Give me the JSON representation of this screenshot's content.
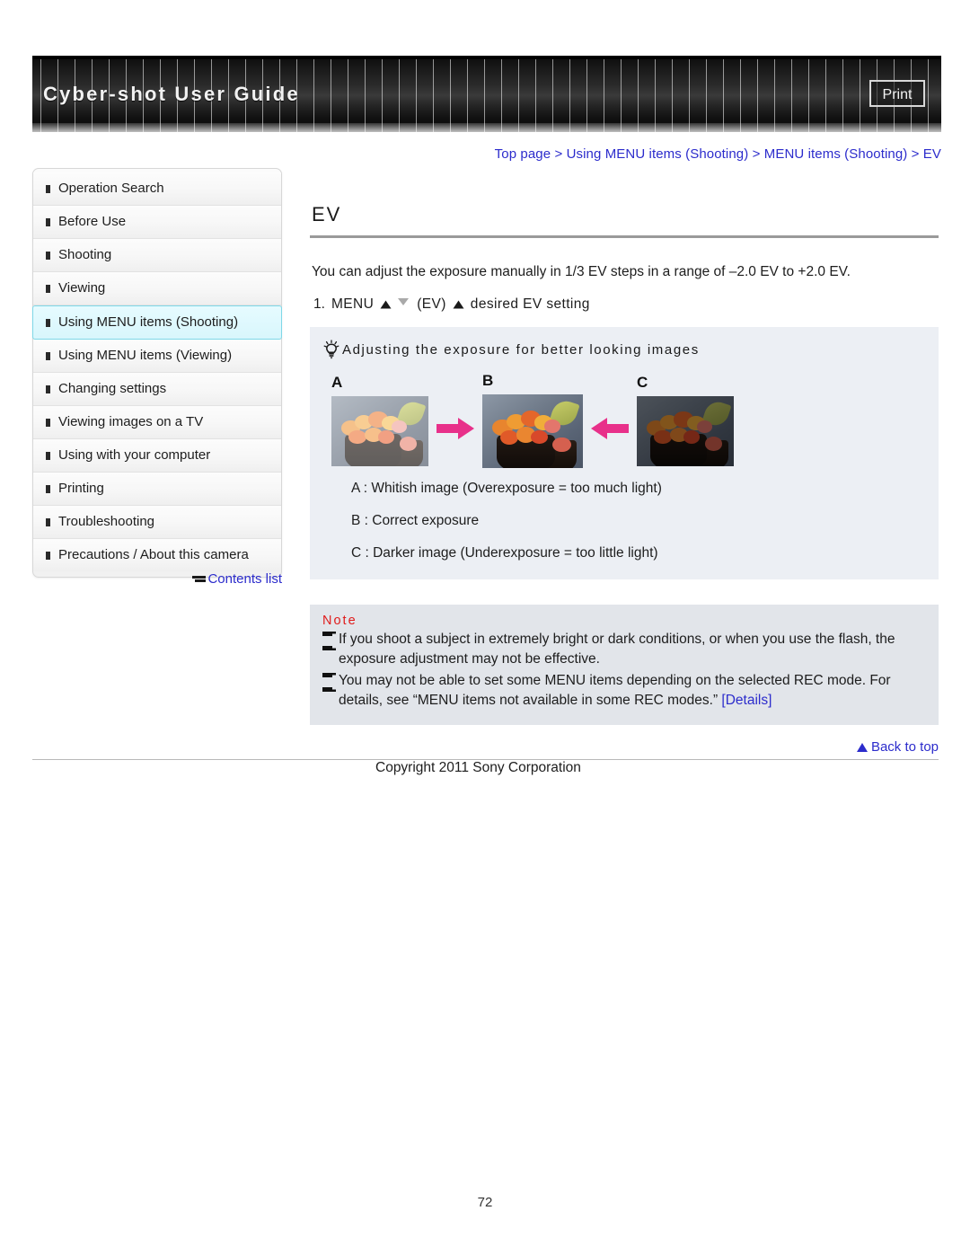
{
  "header": {
    "title": "Cyber-shot User Guide",
    "print_label": "Print"
  },
  "breadcrumb": {
    "text": "Top page > Using MENU items (Shooting) > MENU items (Shooting) > EV"
  },
  "sidebar": {
    "items": [
      {
        "label": "Operation Search",
        "active": false
      },
      {
        "label": "Before Use",
        "active": false
      },
      {
        "label": "Shooting",
        "active": false
      },
      {
        "label": "Viewing",
        "active": false
      },
      {
        "label": "Using MENU items (Shooting)",
        "active": true
      },
      {
        "label": "Using MENU items (Viewing)",
        "active": false
      },
      {
        "label": "Changing settings",
        "active": false
      },
      {
        "label": "Viewing images on a TV",
        "active": false
      },
      {
        "label": "Using with your computer",
        "active": false
      },
      {
        "label": "Printing",
        "active": false
      },
      {
        "label": "Troubleshooting",
        "active": false
      },
      {
        "label": "Precautions / About this camera",
        "active": false
      }
    ],
    "contents_list_label": "Contents list"
  },
  "main": {
    "title": "EV",
    "intro": "You can adjust the exposure manually in 1/3 EV steps in a range of –2.0 EV to +2.0 EV.",
    "step": {
      "number": "1.",
      "menu_label": "MENU",
      "ev_label": "(EV)",
      "tail_label": "desired EV setting"
    },
    "tip": {
      "heading": "Adjusting the exposure for better looking images",
      "images": [
        {
          "letter": "A",
          "state": "overexposed"
        },
        {
          "letter": "B",
          "state": "correct"
        },
        {
          "letter": "C",
          "state": "underexposed"
        }
      ],
      "captions": [
        "A : Whitish image (Overexposure = too much light)",
        "B : Correct exposure",
        "C : Darker image (Underexposure = too little light)"
      ]
    },
    "note": {
      "heading": "Note",
      "items": [
        {
          "text": "If you shoot a subject in extremely bright or dark conditions, or when you use the flash, the exposure adjustment may not be effective.",
          "link": ""
        },
        {
          "text": "You may not be able to set some MENU items depending on the selected REC mode. For details, see “MENU items not available in some REC modes.” ",
          "link": "[Details]"
        }
      ]
    }
  },
  "footer": {
    "back_to_top": "Back to top",
    "copyright": "Copyright 2011 Sony Corporation",
    "page_number": "72"
  },
  "colors": {
    "link": "#2c2ccc",
    "note_heading": "#e01b1b",
    "active_nav_bg": "#dcf7fd",
    "tip_bg": "#eceff4",
    "note_bg": "#e2e5ea",
    "arrow_pink": "#e8308a"
  }
}
